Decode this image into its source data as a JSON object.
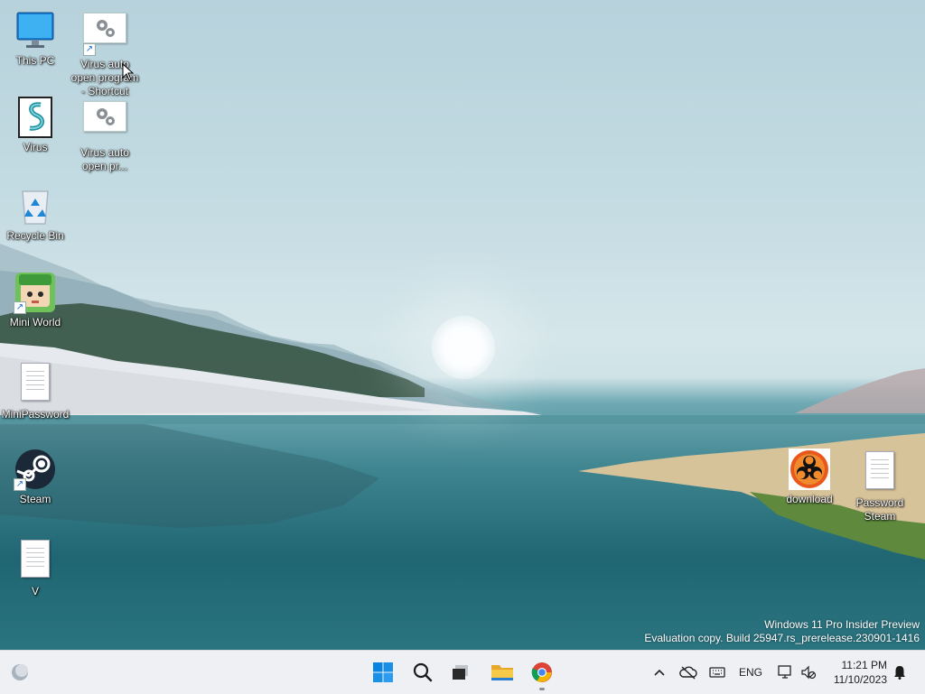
{
  "desktop": {
    "icons": [
      {
        "label": "This PC",
        "icon": "monitor-icon"
      },
      {
        "label": "Virus auto open program - Shortcut",
        "icon": "settings-gear-file-icon"
      },
      {
        "label": "Virus",
        "icon": "script-file-icon"
      },
      {
        "label": "Virus auto open pr...",
        "icon": "settings-gear-file-icon"
      },
      {
        "label": "Recycle Bin",
        "icon": "recycle-bin-icon"
      },
      {
        "label": "Mini World",
        "icon": "mini-world-game-icon"
      },
      {
        "label": "MiniPassword",
        "icon": "text-document-icon"
      },
      {
        "label": "Steam",
        "icon": "steam-icon"
      },
      {
        "label": "V",
        "icon": "text-document-icon"
      },
      {
        "label": "download",
        "icon": "biohazard-icon"
      },
      {
        "label": "Password Steam",
        "icon": "text-document-icon"
      }
    ]
  },
  "watermark": {
    "line1": "Windows 11 Pro Insider Preview",
    "line2": "Evaluation copy. Build 25947.rs_prerelease.230901-1416"
  },
  "taskbar": {
    "left_widget": "weather-widget-icon",
    "pinned": [
      "start-button",
      "search-button",
      "task-view-button",
      "file-explorer-button",
      "chrome-button"
    ],
    "tray": {
      "language": "ENG",
      "time": "11:21 PM",
      "date": "11/10/2023"
    }
  },
  "colors": {
    "taskbar_bg": "#eef0f3",
    "accent": "#0067c0",
    "steam_dark": "#1b2838"
  }
}
